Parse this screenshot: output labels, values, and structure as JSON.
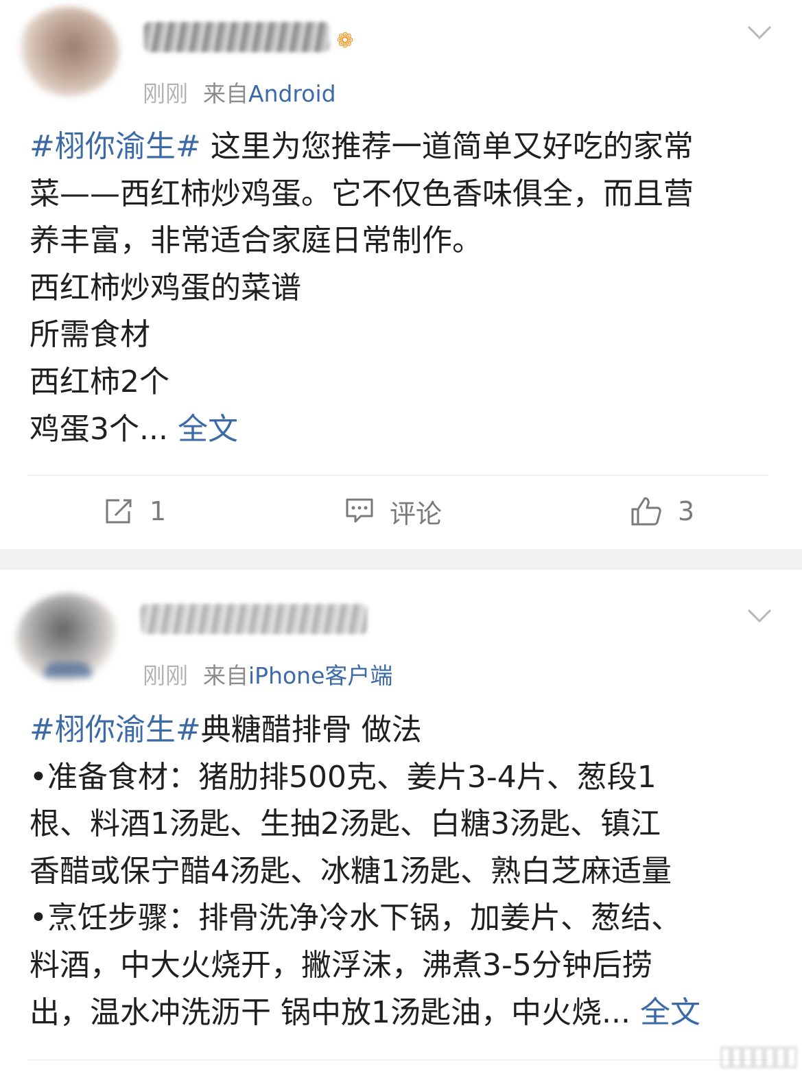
{
  "posts": [
    {
      "time": "刚刚",
      "source_prefix": "来自",
      "source_name": "Android",
      "badge_icon": "fish-badge-icon",
      "lines": [
        {
          "tag": "#栩你渝生#",
          "text": " 这里为您推荐一道简单又好吃的家常"
        },
        {
          "text": "菜——西红柿炒鸡蛋。它不仅色香味俱全，而且营"
        },
        {
          "text": "养丰富，非常适合家庭日常制作。"
        },
        {
          "text": "西红柿炒鸡蛋的菜谱"
        },
        {
          "text": "所需食材"
        },
        {
          "text": "西红柿2个"
        },
        {
          "text": "鸡蛋3个...",
          "more": " 全文"
        }
      ],
      "actions": {
        "repost_count": "1",
        "comment_label": "评论",
        "like_count": "3"
      }
    },
    {
      "time": "刚刚",
      "source_prefix": "来自",
      "source_name": "iPhone客户端",
      "lines": [
        {
          "tag": "#栩你渝生#",
          "text": "典糖醋排骨 做法"
        },
        {
          "text": "•准备食材：猪肋排500克、姜片3-4片、葱段1"
        },
        {
          "text": "根、料酒1汤匙、生抽2汤匙、白糖3汤匙、镇江"
        },
        {
          "text": "香醋或保宁醋4汤匙、冰糖1汤匙、熟白芝麻适量"
        },
        {
          "text": "•烹饪步骤：排骨洗净冷水下锅，加姜片、葱结、"
        },
        {
          "text": "料酒，中大火烧开，撇浮沫，沸煮3-5分钟后捞"
        },
        {
          "text": "出，温水冲洗沥干 锅中放1汤匙油，中火烧...",
          "more": " 全文"
        }
      ]
    }
  ],
  "colors": {
    "link": "#3c6aa7",
    "text": "#1f1f1f",
    "meta": "#8d8d8d",
    "separator": "#f1f1f3"
  }
}
